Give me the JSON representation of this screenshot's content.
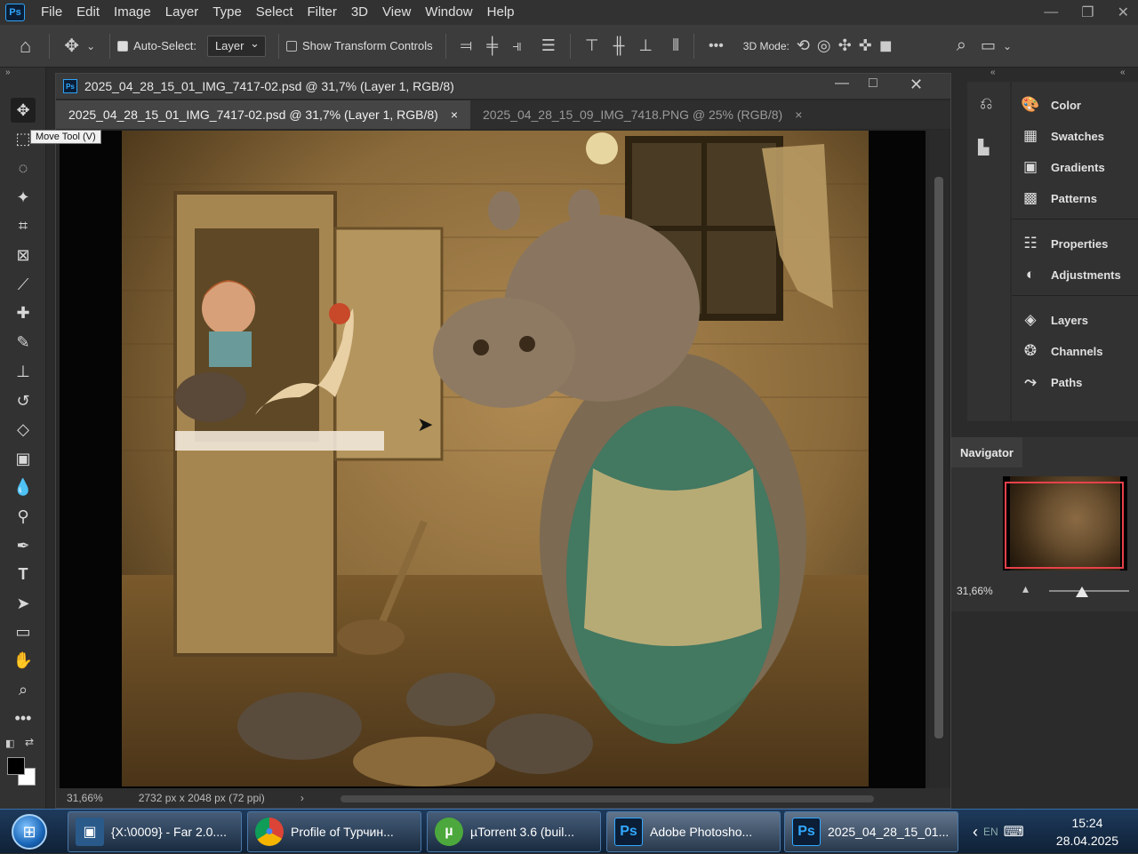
{
  "menubar": {
    "logo": "Ps",
    "items": [
      "File",
      "Edit",
      "Image",
      "Layer",
      "Type",
      "Select",
      "Filter",
      "3D",
      "View",
      "Window",
      "Help"
    ]
  },
  "options": {
    "auto_select_label": "Auto-Select:",
    "auto_select_value": "Layer",
    "show_transform_label": "Show Transform Controls",
    "mode_label": "3D Mode:"
  },
  "toolbar": {
    "tooltip": "Move Tool (V)"
  },
  "document": {
    "window_title": "2025_04_28_15_01_IMG_7417-02.psd @ 31,7% (Layer 1, RGB/8)",
    "tabs": [
      {
        "label": "2025_04_28_15_01_IMG_7417-02.psd @ 31,7% (Layer 1, RGB/8)",
        "close": "×"
      },
      {
        "label": "2025_04_28_15_09_IMG_7418.PNG @ 25% (RGB/8)",
        "close": "×"
      }
    ],
    "status_zoom": "31,66%",
    "status_info": "2732 px x 2048 px (72 ppi)",
    "status_arrow": "›"
  },
  "panels": {
    "items": [
      "Color",
      "Swatches",
      "Gradients",
      "Patterns",
      "Properties",
      "Adjustments",
      "Layers",
      "Channels",
      "Paths"
    ]
  },
  "navigator": {
    "tab": "Navigator",
    "zoom": "31,66%"
  },
  "taskbar": {
    "tasks": [
      {
        "label": "{X:\\0009} - Far 2.0....",
        "icon": "▣",
        "color": "#2a5a8a"
      },
      {
        "label": "Profile of Турчин...",
        "icon": "●",
        "color": "#e8e8e8"
      },
      {
        "label": "µTorrent 3.6  (buil...",
        "icon": "µ",
        "color": "#4ca83c"
      },
      {
        "label": "Adobe Photosho...",
        "icon": "Ps",
        "color": "#0b1e36"
      },
      {
        "label": "2025_04_28_15_01...",
        "icon": "Ps",
        "color": "#0b1e36"
      }
    ],
    "lang": "EN",
    "time": "15:24",
    "date": "28.04.2025"
  }
}
